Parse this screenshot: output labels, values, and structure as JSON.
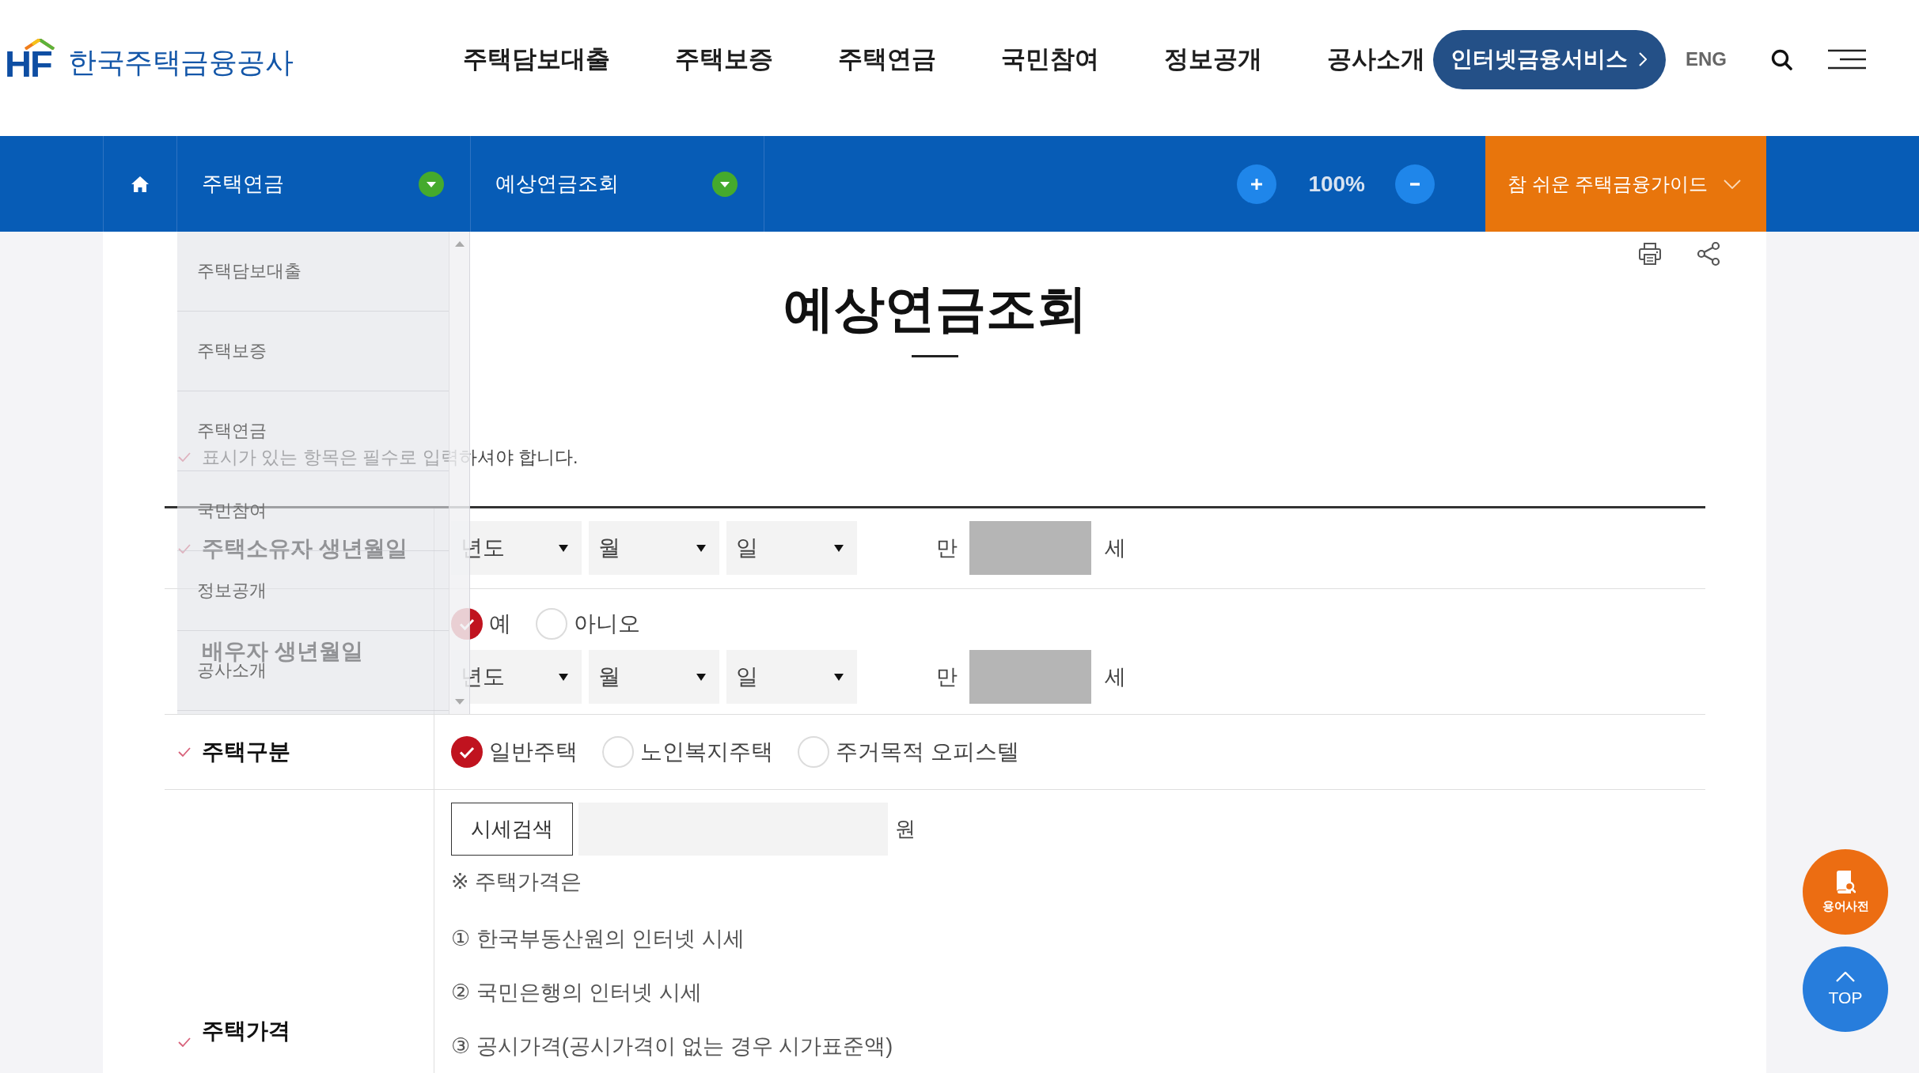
{
  "header": {
    "logo": {
      "mark": "HF",
      "name": "한국주택금융공사"
    },
    "nav": [
      "주택담보대출",
      "주택보증",
      "주택연금",
      "국민참여",
      "정보공개",
      "공사소개"
    ],
    "service_button": "인터넷금융서비스",
    "language": "ENG"
  },
  "breadcrumb": {
    "items": [
      {
        "label": "주택연금",
        "expanded": true,
        "options": [
          "주택담보대출",
          "주택보증",
          "주택연금",
          "국민참여",
          "정보공개",
          "공사소개"
        ]
      },
      {
        "label": "예상연금조회",
        "expanded": false
      }
    ],
    "zoom_level": "100%",
    "guide": "참 쉬운 주택금융가이드"
  },
  "title": "예상연금조회",
  "notice": "표시가 있는 항목은 필수로 입력하셔야 합니다.",
  "form": {
    "rows": [
      {
        "kind": "birthdate",
        "label": "주택소유자 생년월일",
        "required": true,
        "selects": [
          "년도",
          "월",
          "일"
        ],
        "age_prefix": "만",
        "age_suffix": "세"
      },
      {
        "kind": "birthdate",
        "label": "배우자 생년월일",
        "required": false,
        "radios": [
          {
            "label": "예",
            "selected": true
          },
          {
            "label": "아니오",
            "selected": false
          }
        ],
        "selects": [
          "년도",
          "월",
          "일"
        ],
        "age_prefix": "만",
        "age_suffix": "세"
      },
      {
        "kind": "choice",
        "label": "주택구분",
        "required": true,
        "radios": [
          {
            "label": "일반주택",
            "selected": true
          },
          {
            "label": "노인복지주택",
            "selected": false
          },
          {
            "label": "주거목적 오피스텔",
            "selected": false
          }
        ]
      },
      {
        "kind": "price",
        "label": "주택가격",
        "required": true,
        "button": "시세검색",
        "unit": "원",
        "note": "※ 주택가격은",
        "sources": [
          "① 한국부동산원의 인터넷 시세",
          "② 국민은행의 인터넷 시세",
          "③ 공시가격(공시가격이 없는 경우 시가표준액)"
        ]
      }
    ]
  },
  "floating": [
    {
      "kind": "dictionary",
      "label": "용어사전"
    },
    {
      "kind": "top",
      "label": "TOP"
    }
  ]
}
